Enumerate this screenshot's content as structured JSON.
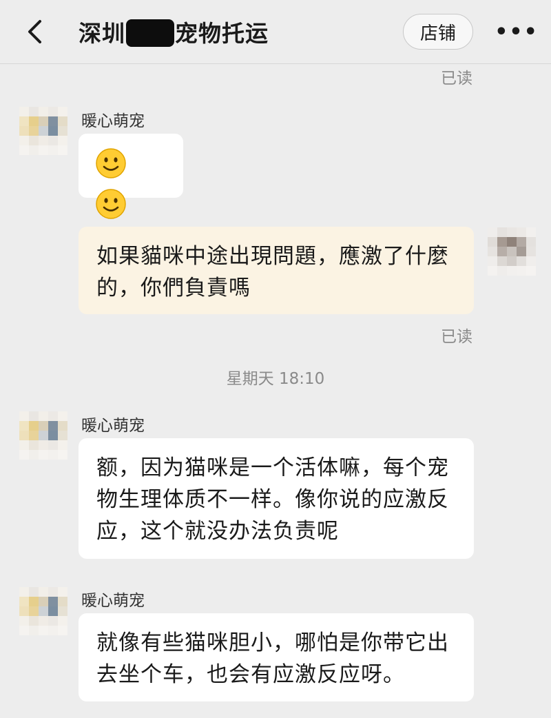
{
  "header": {
    "title_prefix": "深圳",
    "title_suffix": "宠物托运",
    "store_label": "店铺",
    "more_label": "•••"
  },
  "messages": {
    "read_label": "已读",
    "timestamp": "星期天 18:10",
    "incoming_sender": "暖心萌宠",
    "outgoing_1": "如果貓咪中途出現問題，應激了什麼的，你們負責嗎",
    "incoming_2": "额，因为猫咪是一个活体嘛，每个宠物生理体质不一样。像你说的应激反应，这个就没办法负责呢",
    "incoming_3": "就像有些猫咪胆小，哪怕是你带它出去坐个车，也会有应激反应呀。"
  },
  "icons": {
    "back": "chevron-left-icon",
    "emoji": "slightly-smiling-face-icon"
  }
}
